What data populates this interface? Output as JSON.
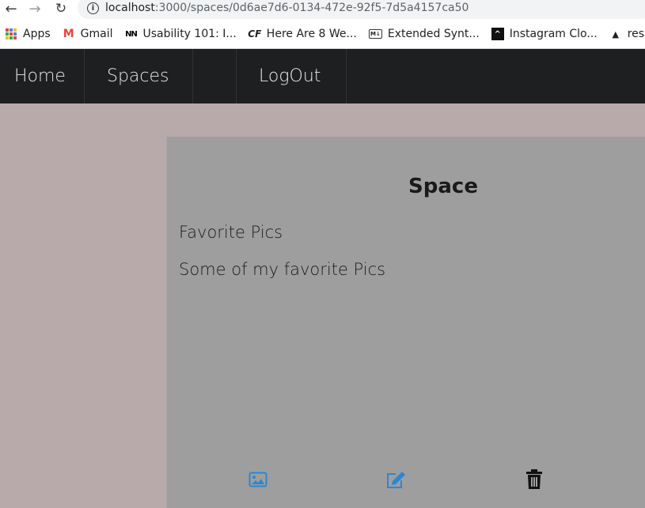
{
  "browser": {
    "url_host": "localhost",
    "url_path": ":3000/spaces/0d6ae7d6-0134-472e-92f5-7d5a4157ca50",
    "bookmarks": [
      {
        "label": "Apps",
        "icon": "apps-grid-icon"
      },
      {
        "label": "Gmail",
        "icon": "gmail-icon"
      },
      {
        "label": "Usability 101: I...",
        "icon": "nn-icon"
      },
      {
        "label": "Here Are 8 We...",
        "icon": "cf-icon"
      },
      {
        "label": "Extended Synt...",
        "icon": "markdown-icon"
      },
      {
        "label": "Instagram Clo...",
        "icon": "caret-up-icon"
      },
      {
        "label": "res",
        "icon": "triangle-icon"
      }
    ]
  },
  "navbar": {
    "home_label": "Home",
    "spaces_label": "Spaces",
    "logout_label": "LogOut"
  },
  "space": {
    "title": "Space",
    "name": "Favorite Pics",
    "description": "Some of my favorite Pics"
  },
  "actions": {
    "image_icon": "image-icon",
    "edit_icon": "edit-icon",
    "delete_icon": "trash-icon"
  },
  "colors": {
    "navbar_bg": "#1d1f20",
    "page_bg": "#b8a9aa",
    "card_bg": "#9e9e9e",
    "accent_blue": "#2f86d0"
  }
}
